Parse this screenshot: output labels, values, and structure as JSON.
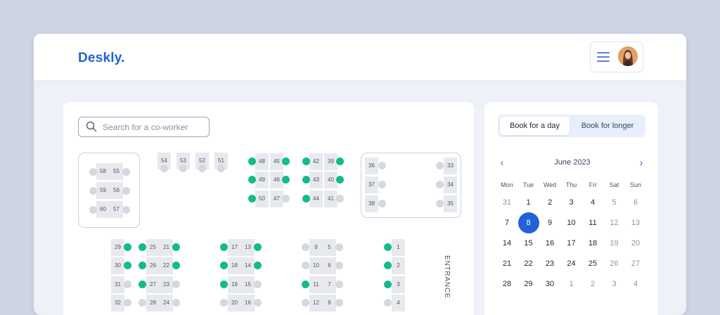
{
  "app": {
    "logo": "Deskly."
  },
  "search": {
    "placeholder": "Search for a co-worker"
  },
  "floor": {
    "entrance_label": "ENTRANCE",
    "desks": [
      {
        "n": "58",
        "free": false
      },
      {
        "n": "55",
        "free": false
      },
      {
        "n": "59",
        "free": false
      },
      {
        "n": "56",
        "free": false
      },
      {
        "n": "60",
        "free": false
      },
      {
        "n": "57",
        "free": false
      },
      {
        "n": "54",
        "free": false
      },
      {
        "n": "53",
        "free": false
      },
      {
        "n": "52",
        "free": false
      },
      {
        "n": "51",
        "free": false
      },
      {
        "n": "48",
        "free": true
      },
      {
        "n": "45",
        "free": true
      },
      {
        "n": "49",
        "free": true
      },
      {
        "n": "46",
        "free": true
      },
      {
        "n": "50",
        "free": true
      },
      {
        "n": "47",
        "free": false
      },
      {
        "n": "42",
        "free": true
      },
      {
        "n": "39",
        "free": true
      },
      {
        "n": "43",
        "free": true
      },
      {
        "n": "40",
        "free": true
      },
      {
        "n": "44",
        "free": true
      },
      {
        "n": "41",
        "free": false
      },
      {
        "n": "36",
        "free": false
      },
      {
        "n": "33",
        "free": false
      },
      {
        "n": "37",
        "free": false
      },
      {
        "n": "34",
        "free": false
      },
      {
        "n": "38",
        "free": false
      },
      {
        "n": "35",
        "free": false
      },
      {
        "n": "29",
        "free": true
      },
      {
        "n": "30",
        "free": true
      },
      {
        "n": "31",
        "free": false
      },
      {
        "n": "32",
        "free": false
      },
      {
        "n": "25",
        "free": true
      },
      {
        "n": "21",
        "free": true
      },
      {
        "n": "26",
        "free": true
      },
      {
        "n": "22",
        "free": true
      },
      {
        "n": "27",
        "free": true
      },
      {
        "n": "23",
        "free": false
      },
      {
        "n": "28",
        "free": false
      },
      {
        "n": "24",
        "free": false
      },
      {
        "n": "17",
        "free": true
      },
      {
        "n": "13",
        "free": true
      },
      {
        "n": "18",
        "free": true
      },
      {
        "n": "14",
        "free": true
      },
      {
        "n": "19",
        "free": true
      },
      {
        "n": "15",
        "free": false
      },
      {
        "n": "20",
        "free": false
      },
      {
        "n": "16",
        "free": false
      },
      {
        "n": "9",
        "free": false
      },
      {
        "n": "5",
        "free": false
      },
      {
        "n": "10",
        "free": false
      },
      {
        "n": "6",
        "free": false
      },
      {
        "n": "11",
        "free": true
      },
      {
        "n": "7",
        "free": false
      },
      {
        "n": "12",
        "free": false
      },
      {
        "n": "8",
        "free": false
      },
      {
        "n": "1",
        "free": true
      },
      {
        "n": "2",
        "free": true
      },
      {
        "n": "3",
        "free": true
      },
      {
        "n": "4",
        "free": false
      }
    ]
  },
  "booking": {
    "tab_day": "Book for a day",
    "tab_longer": "Book for longer",
    "active_tab": "day"
  },
  "calendar": {
    "month_label": "June 2023",
    "weekdays": [
      "Mon",
      "Tue",
      "Wed",
      "Thu",
      "Fri",
      "Sat",
      "Sun"
    ],
    "selected": "8",
    "days": [
      {
        "d": "31",
        "m": true
      },
      {
        "d": "1",
        "m": false
      },
      {
        "d": "2",
        "m": false
      },
      {
        "d": "3",
        "m": false
      },
      {
        "d": "4",
        "m": false
      },
      {
        "d": "5",
        "m": true
      },
      {
        "d": "6",
        "m": true
      },
      {
        "d": "7",
        "m": false
      },
      {
        "d": "8",
        "m": false
      },
      {
        "d": "9",
        "m": false
      },
      {
        "d": "10",
        "m": false
      },
      {
        "d": "11",
        "m": false
      },
      {
        "d": "12",
        "m": true
      },
      {
        "d": "13",
        "m": true
      },
      {
        "d": "14",
        "m": false
      },
      {
        "d": "15",
        "m": false
      },
      {
        "d": "16",
        "m": false
      },
      {
        "d": "17",
        "m": false
      },
      {
        "d": "18",
        "m": false
      },
      {
        "d": "19",
        "m": true
      },
      {
        "d": "20",
        "m": true
      },
      {
        "d": "21",
        "m": false
      },
      {
        "d": "22",
        "m": false
      },
      {
        "d": "23",
        "m": false
      },
      {
        "d": "24",
        "m": false
      },
      {
        "d": "25",
        "m": false
      },
      {
        "d": "26",
        "m": true
      },
      {
        "d": "27",
        "m": true
      },
      {
        "d": "28",
        "m": false
      },
      {
        "d": "29",
        "m": false
      },
      {
        "d": "30",
        "m": false
      },
      {
        "d": "1",
        "m": true
      },
      {
        "d": "2",
        "m": true
      },
      {
        "d": "3",
        "m": true
      },
      {
        "d": "4",
        "m": true
      }
    ]
  },
  "colors": {
    "brand": "#2262d6",
    "available": "#12bb8c",
    "occupied": "#d5d8de"
  }
}
